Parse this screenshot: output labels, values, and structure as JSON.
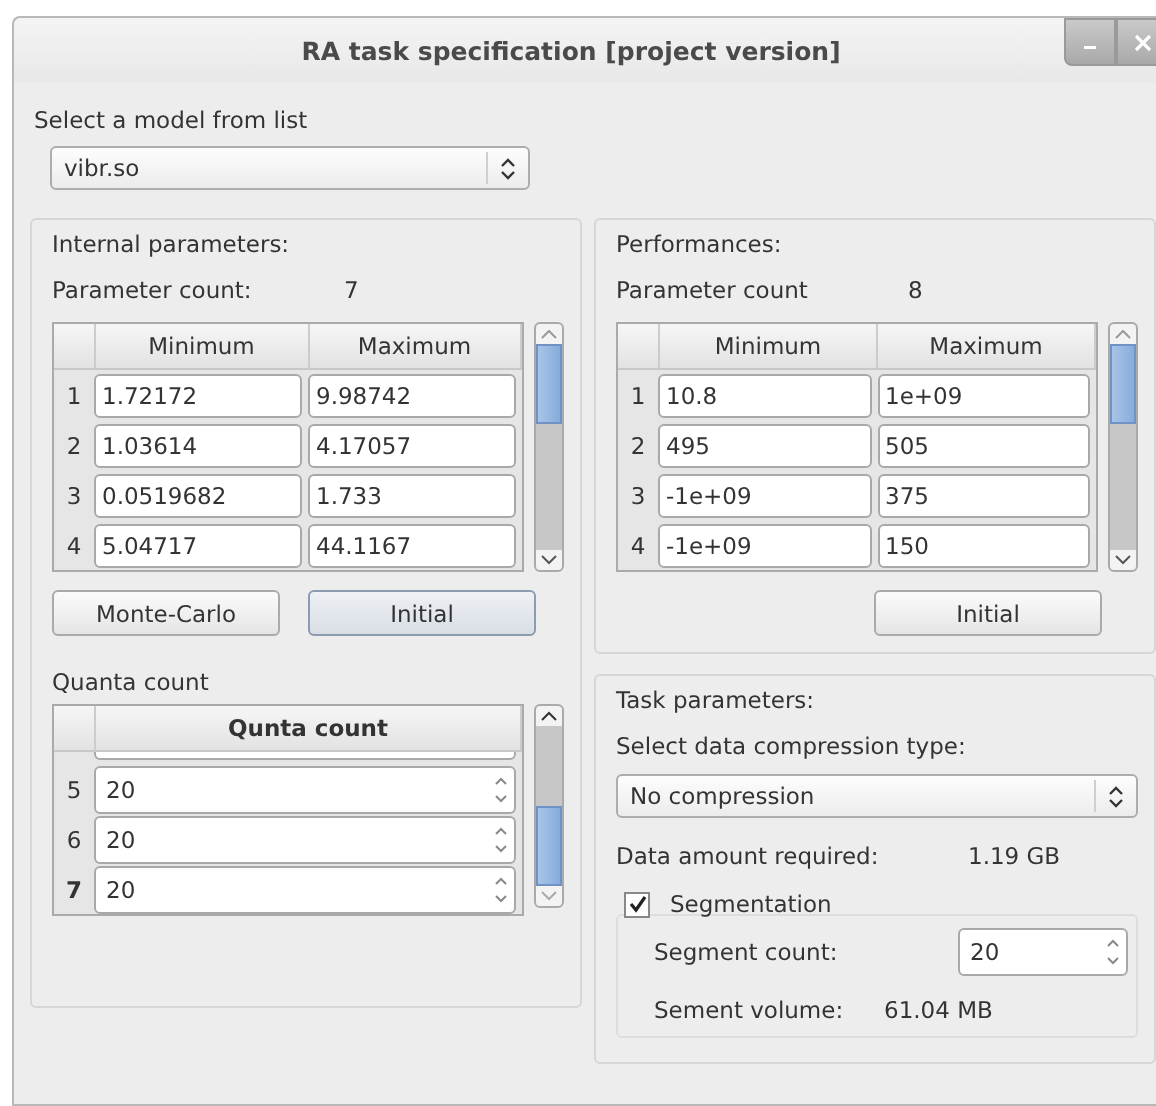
{
  "window": {
    "title": "RA task specification [project version]"
  },
  "model": {
    "label": "Select a model from list",
    "value": "vibr.so"
  },
  "internal": {
    "title": "Internal parameters:",
    "count_label": "Parameter count:",
    "count": "7",
    "columns": [
      "Minimum",
      "Maximum"
    ],
    "rows": [
      {
        "index": "1",
        "minimum": "1.72172",
        "maximum": "9.98742"
      },
      {
        "index": "2",
        "minimum": "1.03614",
        "maximum": "4.17057"
      },
      {
        "index": "3",
        "minimum": "0.0519682",
        "maximum": "1.733"
      },
      {
        "index": "4",
        "minimum": "5.04717",
        "maximum": "44.1167"
      }
    ],
    "buttons": [
      {
        "label": "Monte-Carlo",
        "default": false
      },
      {
        "label": "Initial",
        "default": true
      }
    ]
  },
  "quanta": {
    "title": "Quanta count",
    "column": "Qunta count",
    "rows": [
      {
        "index": "5",
        "value": "20",
        "current": false
      },
      {
        "index": "6",
        "value": "20",
        "current": false
      },
      {
        "index": "7",
        "value": "20",
        "current": true
      }
    ]
  },
  "performances": {
    "title": "Performances:",
    "count_label": "Parameter count",
    "count": "8",
    "columns": [
      "Minimum",
      "Maximum"
    ],
    "rows": [
      {
        "index": "1",
        "minimum": "10.8",
        "maximum": "1e+09"
      },
      {
        "index": "2",
        "minimum": "495",
        "maximum": "505"
      },
      {
        "index": "3",
        "minimum": "-1e+09",
        "maximum": "375"
      },
      {
        "index": "4",
        "minimum": "-1e+09",
        "maximum": "150"
      }
    ],
    "buttons": [
      {
        "label": "Initial",
        "default": false
      }
    ]
  },
  "task": {
    "title": "Task parameters:",
    "compression_label": "Select data compression type:",
    "compression": "No compression",
    "amount_label": "Data amount required:",
    "amount": "1.19 GB",
    "segmentation": {
      "label": "Segmentation",
      "checked": true,
      "count_label": "Segment count:",
      "count": "20",
      "volume_label": "Sement volume:",
      "volume": "61.04 MB"
    }
  }
}
